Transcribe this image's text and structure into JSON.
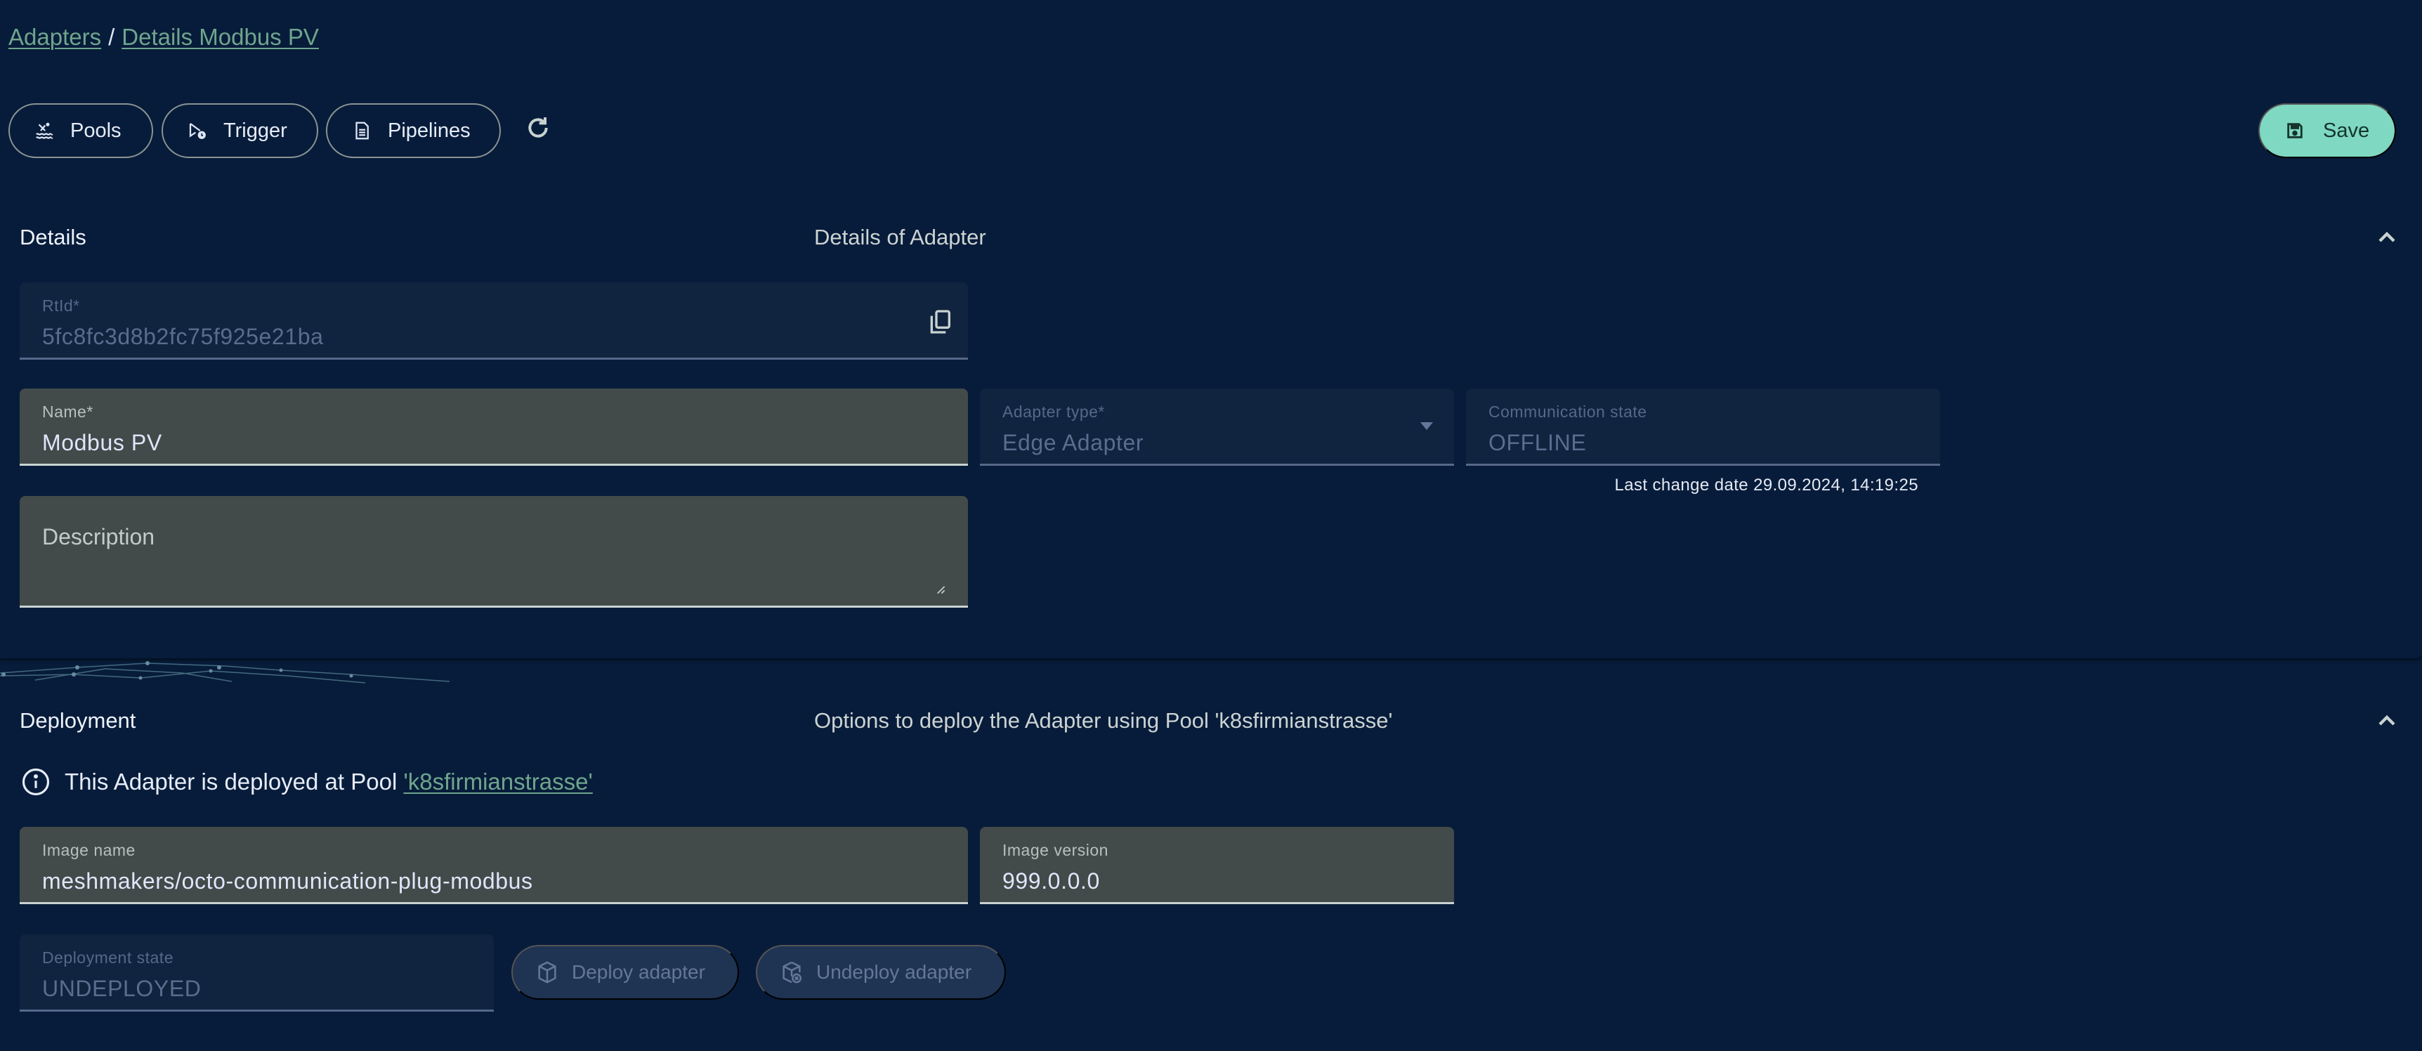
{
  "breadcrumb": {
    "items": [
      {
        "label": "Adapters"
      },
      {
        "label": "Details Modbus PV"
      }
    ],
    "separator": "/"
  },
  "toolbar": {
    "pools_label": "Pools",
    "trigger_label": "Trigger",
    "pipelines_label": "Pipelines",
    "save_label": "Save",
    "icons": {
      "pools": "pool-swimmer-icon",
      "trigger": "trigger-clock-icon",
      "pipelines": "document-icon",
      "refresh": "refresh-icon",
      "save": "floppy-disk-icon"
    },
    "accent_color": "#7fd8c2"
  },
  "details": {
    "title": "Details",
    "description": "Details of Adapter",
    "rtid": {
      "label": "RtId*",
      "value": "5fc8fc3d8b2fc75f925e21ba"
    },
    "name": {
      "label": "Name*",
      "value": "Modbus PV"
    },
    "adapter_type": {
      "label": "Adapter type*",
      "value": "Edge Adapter"
    },
    "communication_state": {
      "label": "Communication state",
      "value": "OFFLINE"
    },
    "last_change": "Last change date 29.09.2024, 14:19:25",
    "description_field": {
      "placeholder": "Description",
      "value": ""
    }
  },
  "deployment": {
    "title": "Deployment",
    "description": "Options to deploy the Adapter using Pool 'k8sfirmianstrasse'",
    "info_prefix": "This Adapter is deployed at Pool ",
    "info_pool_link": "'k8sfirmianstrasse'",
    "image_name": {
      "label": "Image name",
      "value": "meshmakers/octo-communication-plug-modbus"
    },
    "image_version": {
      "label": "Image version",
      "value": "999.0.0.0"
    },
    "deployment_state": {
      "label": "Deployment state",
      "value": "UNDEPLOYED"
    },
    "deploy_label": "Deploy adapter",
    "undeploy_label": "Undeploy adapter"
  }
}
